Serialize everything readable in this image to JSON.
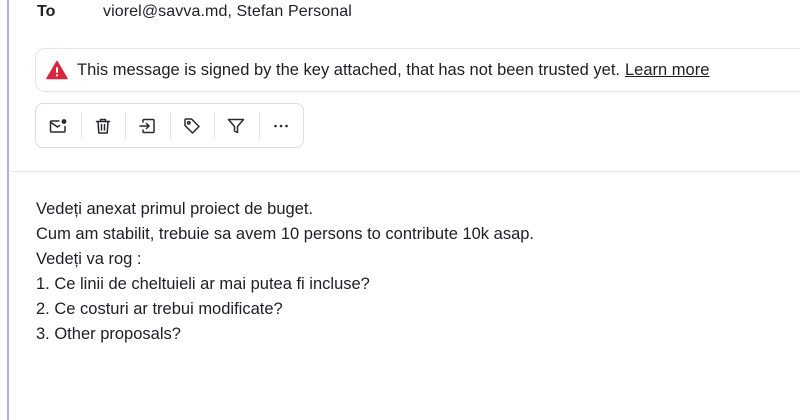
{
  "header": {
    "to_label": "To",
    "recipients": "viorel@savva.md,   Stefan Personal"
  },
  "security_banner": {
    "icon": "warning-triangle-icon",
    "message": "This message is signed by the key attached, that has not been trusted yet.",
    "link_label": "Learn more",
    "icon_color": "#d7263d"
  },
  "toolbar": {
    "buttons": [
      {
        "name": "mark-unread",
        "icon": "mail-unread-icon"
      },
      {
        "name": "delete",
        "icon": "trash-icon"
      },
      {
        "name": "move",
        "icon": "move-to-folder-icon"
      },
      {
        "name": "tag",
        "icon": "tag-icon"
      },
      {
        "name": "filter",
        "icon": "filter-icon"
      },
      {
        "name": "more",
        "icon": "more-horizontal-icon"
      }
    ]
  },
  "message": {
    "lines": [
      "Vedeți anexat primul proiect de buget.",
      "Cum am stabilit, trebuie sa avem 10 persons to contribute 10k asap.",
      "Vedeți va rog :",
      "1. Ce linii de cheltuieli ar mai putea fi incluse?",
      "2. Ce costuri ar trebui modificate?",
      "3. Other proposals?"
    ]
  },
  "colors": {
    "accent_rail": "#b9a7f0",
    "text": "#1f1f23",
    "border": "#e6e6ea"
  }
}
